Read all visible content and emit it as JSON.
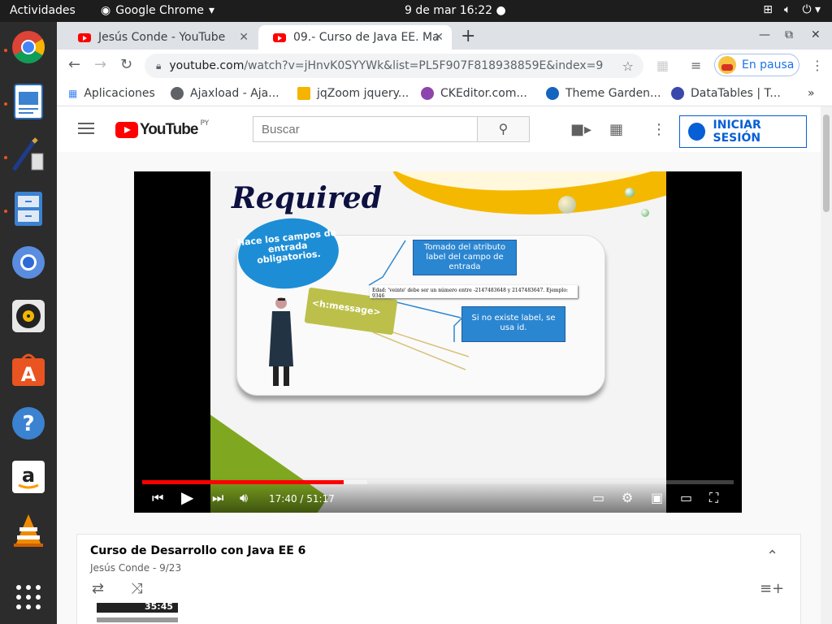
{
  "topbar": {
    "activities": "Actividades",
    "app_name": "Google Chrome",
    "clock": "9 de mar  16:22"
  },
  "dock": {
    "items": [
      "Google Chrome",
      "Document Viewer",
      "Drawing",
      "File Cabinet",
      "Chromium",
      "Rhythmbox",
      "Ubuntu Software",
      "Help",
      "Amazon",
      "VLC",
      "Show Applications"
    ]
  },
  "tabs": [
    {
      "label": "Jesús Conde - YouTube",
      "active": false
    },
    {
      "label": "09.- Curso de Java EE. Ma",
      "active": true
    }
  ],
  "toolbar": {
    "url_host": "youtube.com",
    "url_path": "/watch?v=jHnvK0SYYWk&list=PL5F907F818938859E&index=9",
    "profile_label": "En pausa"
  },
  "bookmarks": [
    {
      "label": "Aplicaciones",
      "color": "#4285f4"
    },
    {
      "label": "Ajaxload - Aja...",
      "color": "#5f6368"
    },
    {
      "label": "jqZoom jquery...",
      "color": "#f4b400"
    },
    {
      "label": "CKEditor.com...",
      "color": "#8e44ad"
    },
    {
      "label": "Theme Garden...",
      "color": "#1565c0"
    },
    {
      "label": "DataTables | T...",
      "color": "#3949ab"
    }
  ],
  "youtube": {
    "logo_text": "YouTube",
    "logo_region": "PY",
    "search_placeholder": "Buscar",
    "signin_label": "INICIAR SESIÓN"
  },
  "video": {
    "slide": {
      "title": "Required",
      "bubble": "Hace los campos de entrada obligatorios.",
      "box1": "Tomado del atributo label del campo de entrada",
      "box2": "Si no existe label, se usa id.",
      "tag": "<h:message>",
      "message": "Edad: 'veinte' debe ser un número entre -2147483648 y 2147483647. Ejemplo: 9346"
    },
    "time": "17:40 / 51:17",
    "progress_fraction": 0.34,
    "buffer_fraction": 0.38
  },
  "playlist": {
    "title": "Curso de Desarrollo con Java EE 6",
    "subtitle": "Jesús Conde - 9/23",
    "thumb_duration": "35:45"
  }
}
